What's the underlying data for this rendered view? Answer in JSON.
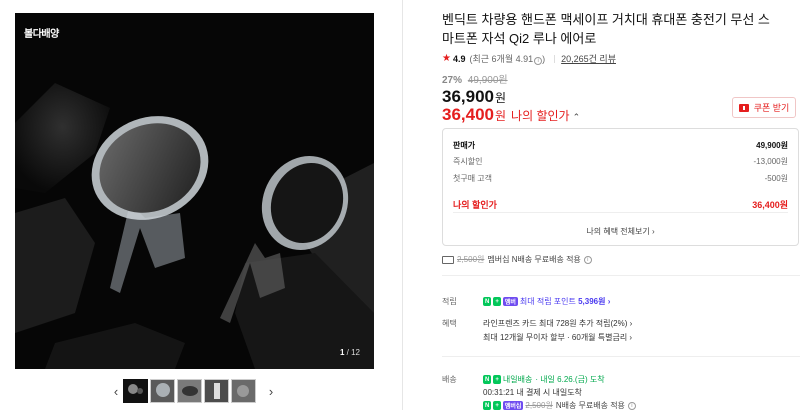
{
  "gallery": {
    "brand": "볼다배양",
    "counter_current": "1",
    "counter_total": "/ 12",
    "prev_arrow": "‹",
    "next_arrow": "›",
    "thumbnail_count": 5
  },
  "product": {
    "title": "벤딕트 차량용 핸드폰 맥세이프 거치대 휴대폰 충전기 무선 스마트폰 자석 Qi2 루나 에어로",
    "rating": "4.9",
    "recent_rating": "(최근 6개월 4.91",
    "recent_rating_close": ")",
    "reviews": "20,265건 리뷰",
    "discount_pct": "27%",
    "original_price": "49,900원",
    "price": "36,900",
    "price_unit": "원",
    "my_price": "36,400",
    "my_price_unit": "원",
    "my_price_label": "나의 할인가",
    "coupon_label": "쿠폰 받기"
  },
  "breakdown": {
    "rows": [
      {
        "label": "판매가",
        "value": "49,900원"
      },
      {
        "label": "즉시할인",
        "value": "-13,000원"
      },
      {
        "label": "첫구매 고객",
        "value": "-500원"
      },
      {
        "label": "나의 할인가",
        "value": "36,400원"
      }
    ],
    "view_all": "나의 혜택 전체보기 ›"
  },
  "shipping": {
    "fee": "2,500원",
    "text": "멤버십 N배송 무료배송 적용"
  },
  "benefits": {
    "points_label": "적립",
    "badge_n": "N",
    "badge_plus": "+",
    "badge_membership": "멤버",
    "points_text": "최대 적립 포인트",
    "points_value": "5,396원 ›",
    "benefit_label": "혜택",
    "benefit_line1": "라인프렌즈 카드 최대 728원 추가 적립(2%) ›",
    "benefit_line2": "최대 12개월 무이자 할부 · 60개월 특별금리 ›"
  },
  "delivery": {
    "label": "배송",
    "badge_text": "N",
    "badge_plus": "+",
    "badge_tomorrow": "내일배송",
    "eta": "· 내일 6.26.(금) 도착",
    "countdown": "00:31:21 내 결제 시 내일도착",
    "badge_membership": "멤버십",
    "fee": "2,500원",
    "fee_text": "N배송 무료배송 적용"
  },
  "colors": {
    "accent_red": "#e51e1e",
    "naver_green": "#03c75a",
    "membership_purple": "#6f4cf0"
  }
}
